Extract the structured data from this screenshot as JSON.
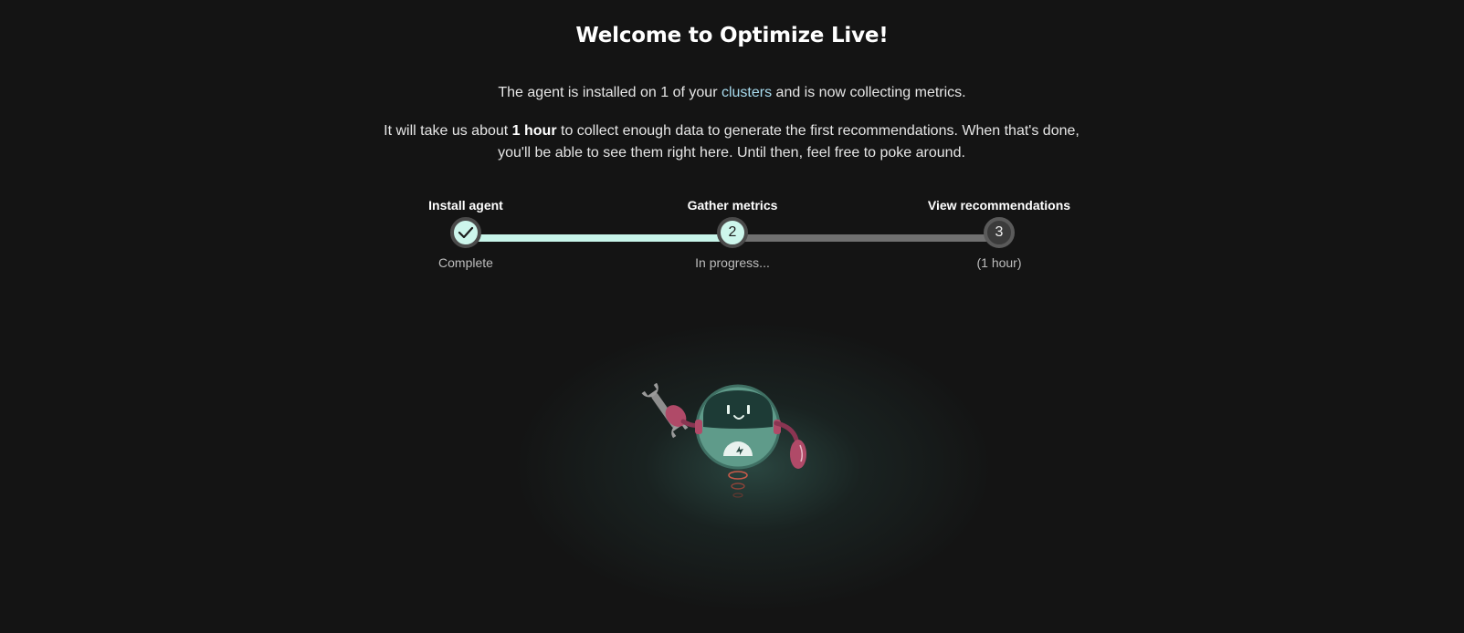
{
  "header": {
    "title": "Welcome to Optimize Live!"
  },
  "intro": {
    "before": "The agent is installed on 1 of your ",
    "link": "clusters",
    "after": " and is now collecting metrics."
  },
  "detail": {
    "before": "It will take us about ",
    "bold": "1 hour",
    "after": " to collect enough data to generate the first recommendations. When that's done, you'll be able to see them right here. Until then, feel free to poke around."
  },
  "stepper": {
    "progress_fraction": 0.5,
    "steps": [
      {
        "label": "Install agent",
        "marker": "check-icon",
        "status": "Complete"
      },
      {
        "label": "Gather metrics",
        "marker": "2",
        "status": "In progress..."
      },
      {
        "label": "View recommendations",
        "marker": "3",
        "status": "(1 hour)"
      }
    ]
  },
  "colors": {
    "background": "#141414",
    "accent_mint": "#c8f5ea",
    "link": "#a9dcef",
    "track_inactive": "#707070",
    "robot_body": "#5f9b8a",
    "robot_arm": "#b04a68"
  },
  "illustration": {
    "name": "robot-mascot-with-wrench"
  }
}
